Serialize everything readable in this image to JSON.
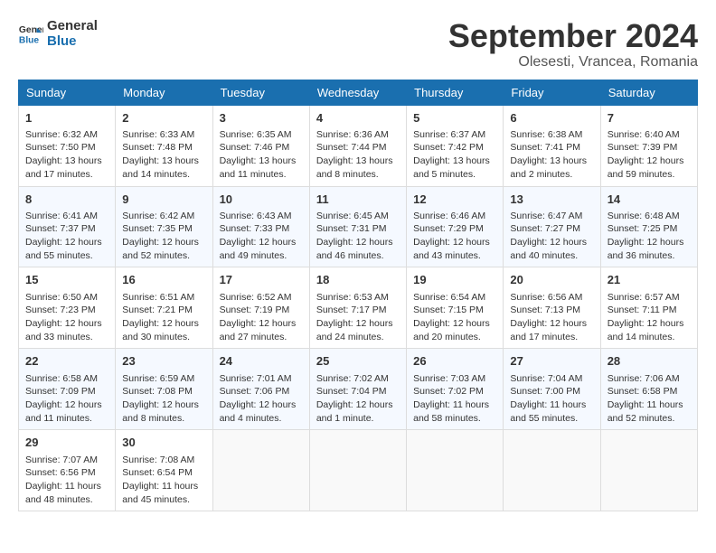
{
  "header": {
    "logo_line1": "General",
    "logo_line2": "Blue",
    "month_title": "September 2024",
    "location": "Olesesti, Vrancea, Romania"
  },
  "columns": [
    "Sunday",
    "Monday",
    "Tuesday",
    "Wednesday",
    "Thursday",
    "Friday",
    "Saturday"
  ],
  "weeks": [
    [
      {
        "day": "1",
        "info": "Sunrise: 6:32 AM\nSunset: 7:50 PM\nDaylight: 13 hours\nand 17 minutes."
      },
      {
        "day": "2",
        "info": "Sunrise: 6:33 AM\nSunset: 7:48 PM\nDaylight: 13 hours\nand 14 minutes."
      },
      {
        "day": "3",
        "info": "Sunrise: 6:35 AM\nSunset: 7:46 PM\nDaylight: 13 hours\nand 11 minutes."
      },
      {
        "day": "4",
        "info": "Sunrise: 6:36 AM\nSunset: 7:44 PM\nDaylight: 13 hours\nand 8 minutes."
      },
      {
        "day": "5",
        "info": "Sunrise: 6:37 AM\nSunset: 7:42 PM\nDaylight: 13 hours\nand 5 minutes."
      },
      {
        "day": "6",
        "info": "Sunrise: 6:38 AM\nSunset: 7:41 PM\nDaylight: 13 hours\nand 2 minutes."
      },
      {
        "day": "7",
        "info": "Sunrise: 6:40 AM\nSunset: 7:39 PM\nDaylight: 12 hours\nand 59 minutes."
      }
    ],
    [
      {
        "day": "8",
        "info": "Sunrise: 6:41 AM\nSunset: 7:37 PM\nDaylight: 12 hours\nand 55 minutes."
      },
      {
        "day": "9",
        "info": "Sunrise: 6:42 AM\nSunset: 7:35 PM\nDaylight: 12 hours\nand 52 minutes."
      },
      {
        "day": "10",
        "info": "Sunrise: 6:43 AM\nSunset: 7:33 PM\nDaylight: 12 hours\nand 49 minutes."
      },
      {
        "day": "11",
        "info": "Sunrise: 6:45 AM\nSunset: 7:31 PM\nDaylight: 12 hours\nand 46 minutes."
      },
      {
        "day": "12",
        "info": "Sunrise: 6:46 AM\nSunset: 7:29 PM\nDaylight: 12 hours\nand 43 minutes."
      },
      {
        "day": "13",
        "info": "Sunrise: 6:47 AM\nSunset: 7:27 PM\nDaylight: 12 hours\nand 40 minutes."
      },
      {
        "day": "14",
        "info": "Sunrise: 6:48 AM\nSunset: 7:25 PM\nDaylight: 12 hours\nand 36 minutes."
      }
    ],
    [
      {
        "day": "15",
        "info": "Sunrise: 6:50 AM\nSunset: 7:23 PM\nDaylight: 12 hours\nand 33 minutes."
      },
      {
        "day": "16",
        "info": "Sunrise: 6:51 AM\nSunset: 7:21 PM\nDaylight: 12 hours\nand 30 minutes."
      },
      {
        "day": "17",
        "info": "Sunrise: 6:52 AM\nSunset: 7:19 PM\nDaylight: 12 hours\nand 27 minutes."
      },
      {
        "day": "18",
        "info": "Sunrise: 6:53 AM\nSunset: 7:17 PM\nDaylight: 12 hours\nand 24 minutes."
      },
      {
        "day": "19",
        "info": "Sunrise: 6:54 AM\nSunset: 7:15 PM\nDaylight: 12 hours\nand 20 minutes."
      },
      {
        "day": "20",
        "info": "Sunrise: 6:56 AM\nSunset: 7:13 PM\nDaylight: 12 hours\nand 17 minutes."
      },
      {
        "day": "21",
        "info": "Sunrise: 6:57 AM\nSunset: 7:11 PM\nDaylight: 12 hours\nand 14 minutes."
      }
    ],
    [
      {
        "day": "22",
        "info": "Sunrise: 6:58 AM\nSunset: 7:09 PM\nDaylight: 12 hours\nand 11 minutes."
      },
      {
        "day": "23",
        "info": "Sunrise: 6:59 AM\nSunset: 7:08 PM\nDaylight: 12 hours\nand 8 minutes."
      },
      {
        "day": "24",
        "info": "Sunrise: 7:01 AM\nSunset: 7:06 PM\nDaylight: 12 hours\nand 4 minutes."
      },
      {
        "day": "25",
        "info": "Sunrise: 7:02 AM\nSunset: 7:04 PM\nDaylight: 12 hours\nand 1 minute."
      },
      {
        "day": "26",
        "info": "Sunrise: 7:03 AM\nSunset: 7:02 PM\nDaylight: 11 hours\nand 58 minutes."
      },
      {
        "day": "27",
        "info": "Sunrise: 7:04 AM\nSunset: 7:00 PM\nDaylight: 11 hours\nand 55 minutes."
      },
      {
        "day": "28",
        "info": "Sunrise: 7:06 AM\nSunset: 6:58 PM\nDaylight: 11 hours\nand 52 minutes."
      }
    ],
    [
      {
        "day": "29",
        "info": "Sunrise: 7:07 AM\nSunset: 6:56 PM\nDaylight: 11 hours\nand 48 minutes."
      },
      {
        "day": "30",
        "info": "Sunrise: 7:08 AM\nSunset: 6:54 PM\nDaylight: 11 hours\nand 45 minutes."
      },
      {
        "day": "",
        "info": ""
      },
      {
        "day": "",
        "info": ""
      },
      {
        "day": "",
        "info": ""
      },
      {
        "day": "",
        "info": ""
      },
      {
        "day": "",
        "info": ""
      }
    ]
  ]
}
